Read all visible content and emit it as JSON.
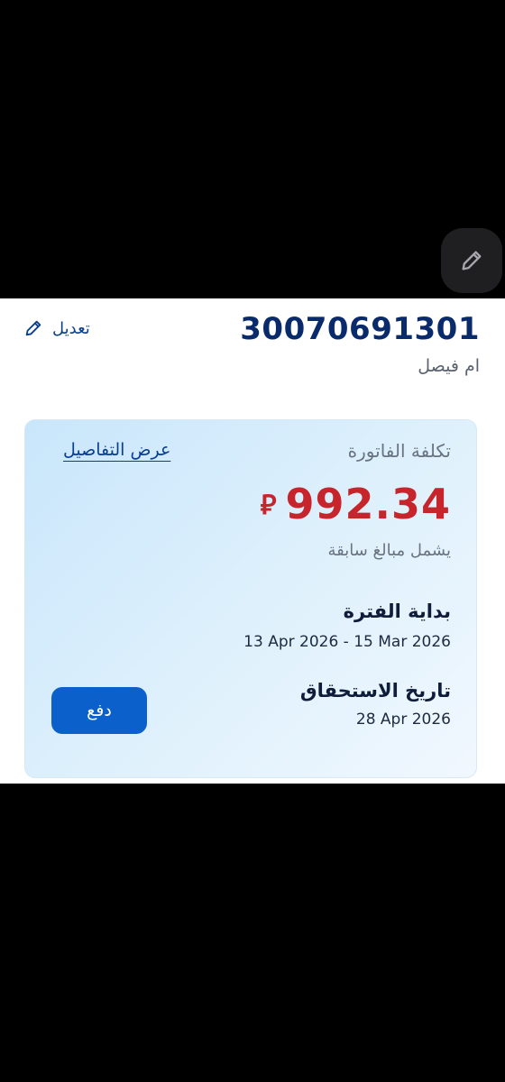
{
  "account": {
    "number": "30070691301",
    "name": "ام فيصل",
    "edit_label": "تعديل"
  },
  "bill": {
    "title": "تكلفة الفاتورة",
    "details_link": "عرض التفاصيل",
    "amount": "992.34",
    "currency_symbol": "⃁",
    "previous_amounts_note": "يشمل مبالغ سابقة",
    "period_label": "بداية الفترة",
    "period_value": "13 Apr 2026 - 15 Mar 2026",
    "due_label": "تاريخ الاستحقاق",
    "due_value": "28 Apr 2026",
    "pay_label": "دفع"
  },
  "icons": {
    "fab": "pencil-icon",
    "edit": "pencil-icon"
  },
  "colors": {
    "amount": "#c6252b",
    "primary_button": "#0b60cc",
    "account_number": "#0a2b6b",
    "link": "#0a3f8f"
  }
}
